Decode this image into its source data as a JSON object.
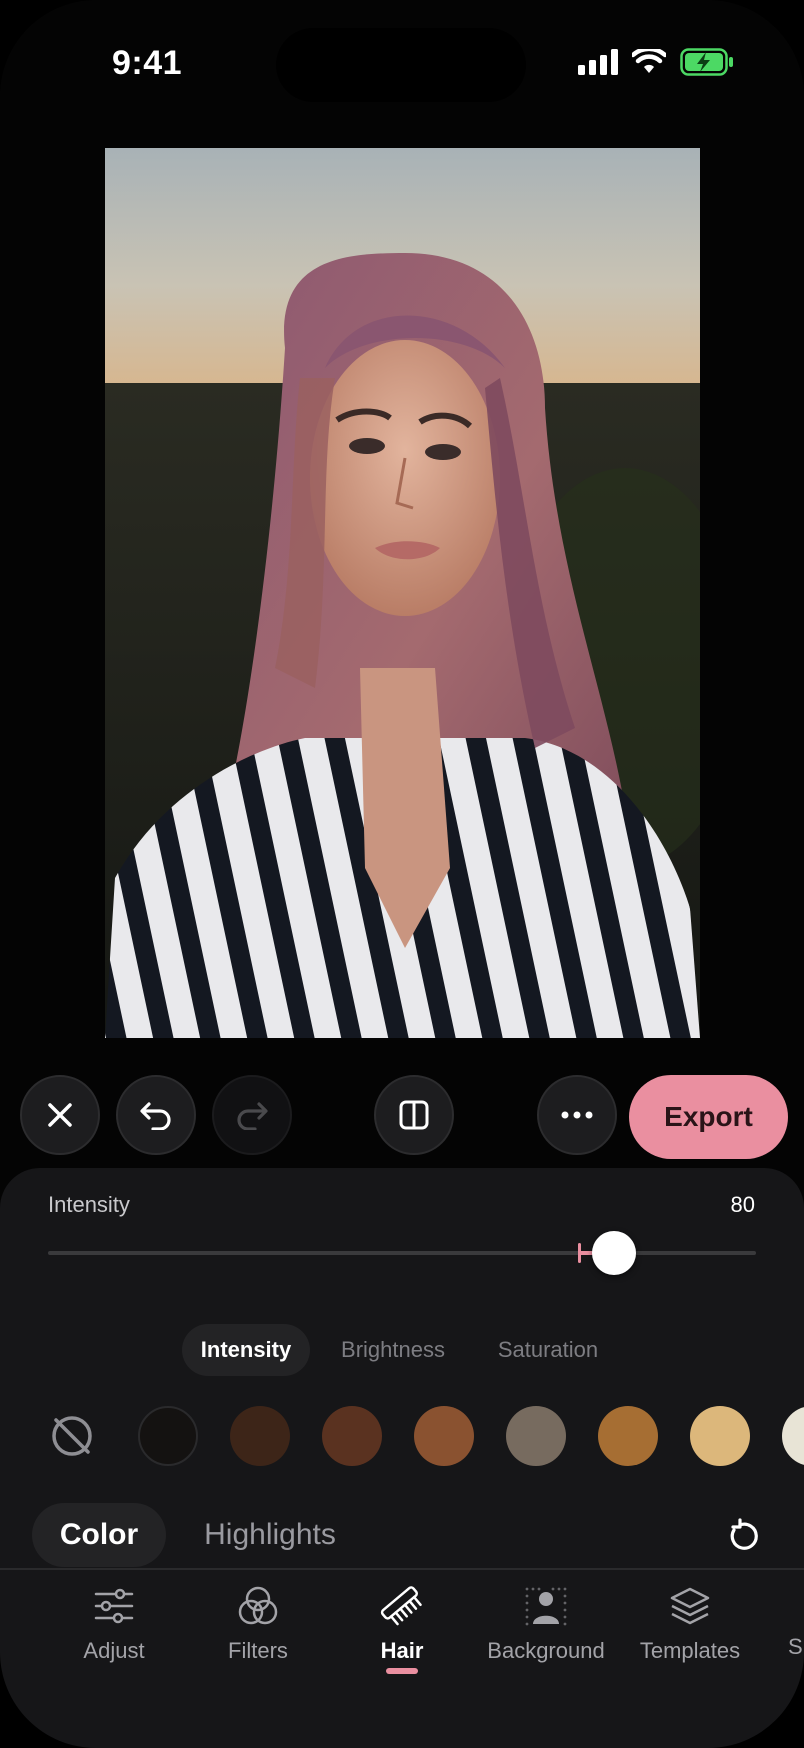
{
  "status_bar": {
    "time": "9:41"
  },
  "toolbar": {
    "export_label": "Export"
  },
  "intensity": {
    "label": "Intensity",
    "value": "80",
    "fraction": 0.8
  },
  "segments": [
    {
      "label": "Intensity",
      "active": true
    },
    {
      "label": "Brightness",
      "active": false
    },
    {
      "label": "Saturation",
      "active": false
    }
  ],
  "swatches": [
    "#141211",
    "#3d2518",
    "#5a3220",
    "#8a5230",
    "#776b5f",
    "#a66e33",
    "#dcb77b",
    "#e8e4d6"
  ],
  "mode_tabs": [
    {
      "label": "Color",
      "active": true
    },
    {
      "label": "Highlights",
      "active": false
    }
  ],
  "bottom_nav": [
    {
      "label": "Adjust",
      "icon": "sliders-icon",
      "active": false
    },
    {
      "label": "Filters",
      "icon": "filters-icon",
      "active": false
    },
    {
      "label": "Hair",
      "icon": "comb-icon",
      "active": true
    },
    {
      "label": "Background",
      "icon": "person-background-icon",
      "active": false
    },
    {
      "label": "Templates",
      "icon": "layers-icon",
      "active": false
    },
    {
      "label": "S",
      "icon": "",
      "active": false
    }
  ],
  "colors": {
    "accent": "#ea8fa0",
    "panel": "#161618",
    "background": "#040404"
  }
}
